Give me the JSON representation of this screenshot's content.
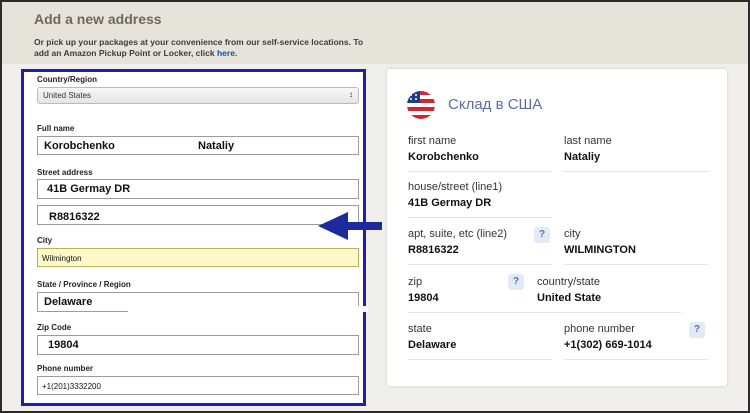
{
  "header": {
    "title": "Add a new address",
    "note_text": "Or pick up your packages at your convenience from our self-service locations. To add an Amazon Pickup Point or Locker, click ",
    "note_link": "here"
  },
  "form": {
    "country_label": "Country/Region",
    "country_value": "United States",
    "fullname_label": "Full name",
    "first_name": "Korobchenko",
    "last_name": "Nataliy",
    "street_label": "Street address",
    "street1": "41B Germay DR",
    "street2": "R8816322",
    "city_label": "City",
    "city_value": "Wilmington",
    "state_label": "State / Province / Region",
    "state_value": "Delaware",
    "zip_label": "Zip Code",
    "zip_value": "19804",
    "phone_label": "Phone number",
    "phone_value": "+1(201)3332200"
  },
  "card": {
    "title": "Склад в США",
    "first_name_label": "first name",
    "first_name": "Korobchenko",
    "last_name_label": "last name",
    "last_name": "Nataliy",
    "line1_label": "house/street (line1)",
    "line1": "41B Germay DR",
    "line2_label": "apt, suite, etc (line2)",
    "line2": "R8816322",
    "city_label": "city",
    "city": "WILMINGTON",
    "zip_label": "zip",
    "zip": "19804",
    "country_label": "country/state",
    "country": "United State",
    "state_label": "state",
    "state": "Delaware",
    "phone_label": "phone number",
    "phone": "+1(302) 669-1014",
    "help_glyph": "?"
  },
  "colors": {
    "form_border": "#1f1fa8",
    "arrow": "#1c2a9e",
    "card_title": "#5a6fa6",
    "city_highlight": "#fdf8c8"
  },
  "icons": {
    "flag": "us-flag-icon",
    "arrow": "left-arrow-icon",
    "help": "question-icon",
    "select": "select-caret-icon"
  }
}
